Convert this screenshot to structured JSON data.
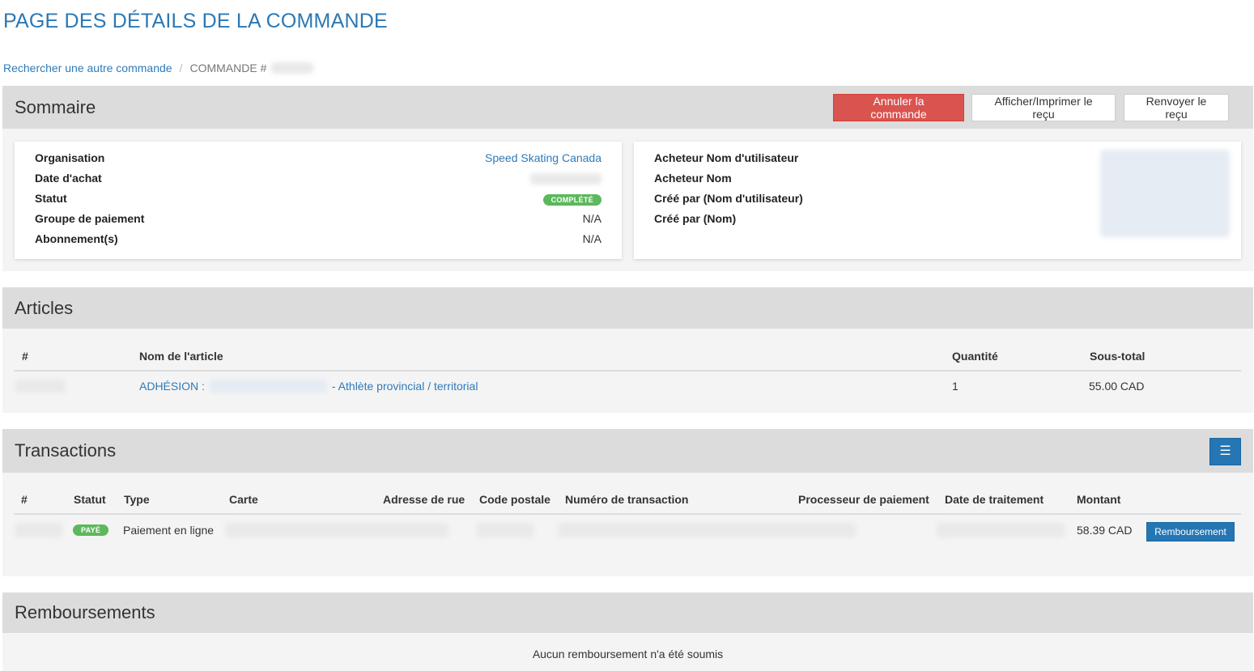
{
  "page_title": "PAGE DES DÉTAILS DE LA COMMANDE",
  "breadcrumb": {
    "search_link": "Rechercher une autre commande",
    "separator": "/",
    "current": "COMMANDE #"
  },
  "summary": {
    "title": "Sommaire",
    "buttons": {
      "cancel": "Annuler la commande",
      "view_print": "Afficher/Imprimer le reçu",
      "resend": "Renvoyer le reçu"
    },
    "left": {
      "organisation_label": "Organisation",
      "organisation_value": "Speed Skating Canada",
      "purchase_date_label": "Date d'achat",
      "status_label": "Statut",
      "status_value": "COMPLÉTÉ",
      "payment_group_label": "Groupe de paiement",
      "payment_group_value": "N/A",
      "subscriptions_label": "Abonnement(s)",
      "subscriptions_value": "N/A"
    },
    "right": {
      "buyer_username_label": "Acheteur Nom d'utilisateur",
      "buyer_name_label": "Acheteur Nom",
      "created_by_username_label": "Créé par (Nom d'utilisateur)",
      "created_by_name_label": "Créé par (Nom)"
    }
  },
  "articles": {
    "title": "Articles",
    "columns": [
      "#",
      "Nom de l'article",
      "Quantité",
      "Sous-total"
    ],
    "rows": [
      {
        "name_prefix": "ADHÉSION :",
        "name_suffix": "- Athlète provincial / territorial",
        "quantity": "1",
        "subtotal": "55.00 CAD"
      }
    ]
  },
  "transactions": {
    "title": "Transactions",
    "menu_icon": "hamburger-icon",
    "columns": [
      "#",
      "Statut",
      "Type",
      "Carte",
      "Adresse de rue",
      "Code postale",
      "Numéro de transaction",
      "Processeur de paiement",
      "Date de traitement",
      "Montant"
    ],
    "rows": [
      {
        "status": "PAYÉ",
        "type": "Paiement en ligne",
        "amount": "58.39 CAD",
        "refund_label": "Remboursement"
      }
    ]
  },
  "refunds": {
    "title": "Remboursements",
    "empty_text": "Aucun remboursement n'a été soumis"
  },
  "colors": {
    "accent": "#2b78b4",
    "danger": "#d9534f",
    "success": "#5cb85c",
    "section_header": "#dcdcdc"
  }
}
